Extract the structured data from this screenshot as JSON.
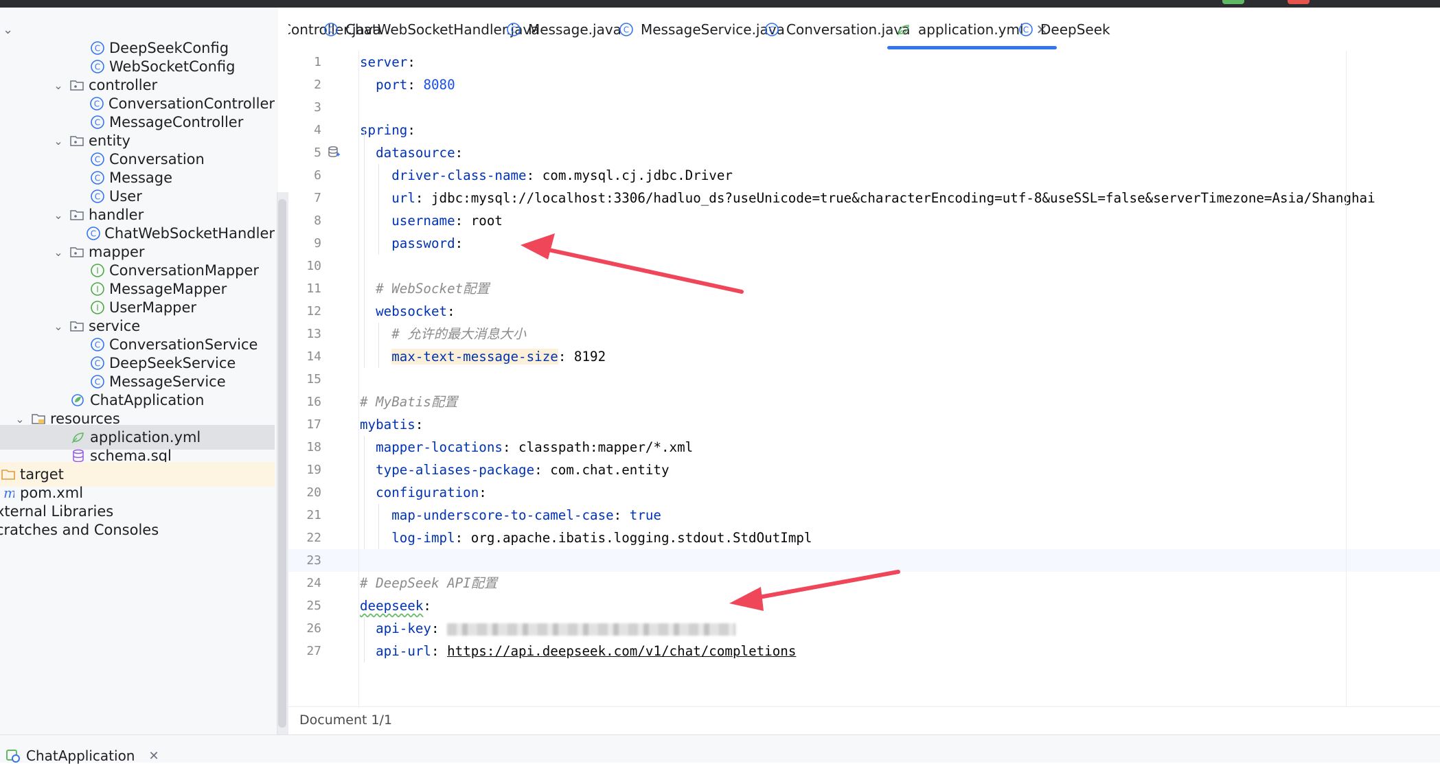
{
  "sidebar": {
    "items": [
      {
        "label": "DeepSeekConfig",
        "indent": 2,
        "icon": "class-icon",
        "expand": ""
      },
      {
        "label": "WebSocketConfig",
        "indent": 2,
        "icon": "class-icon",
        "expand": ""
      },
      {
        "label": "controller",
        "indent": 1,
        "icon": "package-icon",
        "expand": "open"
      },
      {
        "label": "ConversationController",
        "indent": 2,
        "icon": "class-icon",
        "expand": ""
      },
      {
        "label": "MessageController",
        "indent": 2,
        "icon": "class-icon",
        "expand": ""
      },
      {
        "label": "entity",
        "indent": 1,
        "icon": "package-icon",
        "expand": "open"
      },
      {
        "label": "Conversation",
        "indent": 2,
        "icon": "class-icon",
        "expand": ""
      },
      {
        "label": "Message",
        "indent": 2,
        "icon": "class-icon",
        "expand": ""
      },
      {
        "label": "User",
        "indent": 2,
        "icon": "class-icon",
        "expand": ""
      },
      {
        "label": "handler",
        "indent": 1,
        "icon": "package-icon",
        "expand": "open"
      },
      {
        "label": "ChatWebSocketHandler",
        "indent": 2,
        "icon": "class-icon",
        "expand": ""
      },
      {
        "label": "mapper",
        "indent": 1,
        "icon": "package-icon",
        "expand": "open"
      },
      {
        "label": "ConversationMapper",
        "indent": 2,
        "icon": "interface-icon",
        "expand": ""
      },
      {
        "label": "MessageMapper",
        "indent": 2,
        "icon": "interface-icon",
        "expand": ""
      },
      {
        "label": "UserMapper",
        "indent": 2,
        "icon": "interface-icon",
        "expand": ""
      },
      {
        "label": "service",
        "indent": 1,
        "icon": "package-icon",
        "expand": "open"
      },
      {
        "label": "ConversationService",
        "indent": 2,
        "icon": "class-icon",
        "expand": ""
      },
      {
        "label": "DeepSeekService",
        "indent": 2,
        "icon": "class-icon",
        "expand": ""
      },
      {
        "label": "MessageService",
        "indent": 2,
        "icon": "class-icon",
        "expand": ""
      },
      {
        "label": "ChatApplication",
        "indent": 1,
        "icon": "spring-app-icon",
        "expand": ""
      },
      {
        "label": "resources",
        "indent": 0,
        "icon": "resources-folder-icon",
        "expand": "open"
      },
      {
        "label": "application.yml",
        "indent": 1,
        "icon": "yaml-icon",
        "expand": "",
        "state": "selected"
      },
      {
        "label": "schema.sql",
        "indent": 1,
        "icon": "sql-icon",
        "expand": ""
      },
      {
        "label": "target",
        "indent": -1,
        "icon": "folder-icon",
        "expand": "",
        "state": "target"
      },
      {
        "label": "pom.xml",
        "indent": -1,
        "icon": "maven-icon",
        "expand": ""
      },
      {
        "label": "xternal Libraries",
        "indent": -2,
        "icon": "",
        "expand": ""
      },
      {
        "label": "cratches and Consoles",
        "indent": -2,
        "icon": "",
        "expand": ""
      }
    ]
  },
  "tabs": [
    {
      "label": "Controller.java",
      "icon": ""
    },
    {
      "label": "ChatWebSocketHandler.java",
      "icon": "class-icon"
    },
    {
      "label": "Message.java",
      "icon": "class-icon"
    },
    {
      "label": "MessageService.java",
      "icon": "class-icon"
    },
    {
      "label": "Conversation.java",
      "icon": "class-icon"
    },
    {
      "label": "application.yml",
      "icon": "yaml-icon",
      "active": true
    },
    {
      "label": "DeepSeek",
      "icon": "class-icon"
    }
  ],
  "editor": {
    "current_line": 23,
    "lines": [
      {
        "n": "1",
        "t": "server:"
      },
      {
        "n": "2",
        "t": "  port: 8080"
      },
      {
        "n": "3",
        "t": ""
      },
      {
        "n": "4",
        "t": "spring:"
      },
      {
        "n": "5",
        "t": "  datasource:"
      },
      {
        "n": "6",
        "t": "    driver-class-name: com.mysql.cj.jdbc.Driver"
      },
      {
        "n": "7",
        "t": "    url: jdbc:mysql://localhost:3306/hadluo_ds?useUnicode=true&characterEncoding=utf-8&useSSL=false&serverTimezone=Asia/Shanghai"
      },
      {
        "n": "8",
        "t": "    username: root"
      },
      {
        "n": "9",
        "t": "    password:"
      },
      {
        "n": "10",
        "t": ""
      },
      {
        "n": "11",
        "t": "  # WebSocket配置"
      },
      {
        "n": "12",
        "t": "  websocket:"
      },
      {
        "n": "13",
        "t": "    # 允许的最大消息大小"
      },
      {
        "n": "14",
        "t": "    max-text-message-size: 8192"
      },
      {
        "n": "15",
        "t": ""
      },
      {
        "n": "16",
        "t": "# MyBatis配置"
      },
      {
        "n": "17",
        "t": "mybatis:"
      },
      {
        "n": "18",
        "t": "  mapper-locations: classpath:mapper/*.xml"
      },
      {
        "n": "19",
        "t": "  type-aliases-package: com.chat.entity"
      },
      {
        "n": "20",
        "t": "  configuration:"
      },
      {
        "n": "21",
        "t": "    map-underscore-to-camel-case: true"
      },
      {
        "n": "22",
        "t": "    log-impl: org.apache.ibatis.logging.stdout.StdOutImpl"
      },
      {
        "n": "23",
        "t": ""
      },
      {
        "n": "24",
        "t": "# DeepSeek API配置"
      },
      {
        "n": "25",
        "t": "deepseek:"
      },
      {
        "n": "26",
        "t": "  api-key: "
      },
      {
        "n": "27",
        "t": "  api-url: https://api.deepseek.com/v1/chat/completions"
      }
    ]
  },
  "status": {
    "document": "Document 1/1"
  },
  "run_tab": {
    "label": "ChatApplication"
  },
  "colors": {
    "accent": "#3574f0",
    "arrow": "#f0465a",
    "key": "#0033b3",
    "number": "#1750eb",
    "comment": "#8c8c8c"
  }
}
